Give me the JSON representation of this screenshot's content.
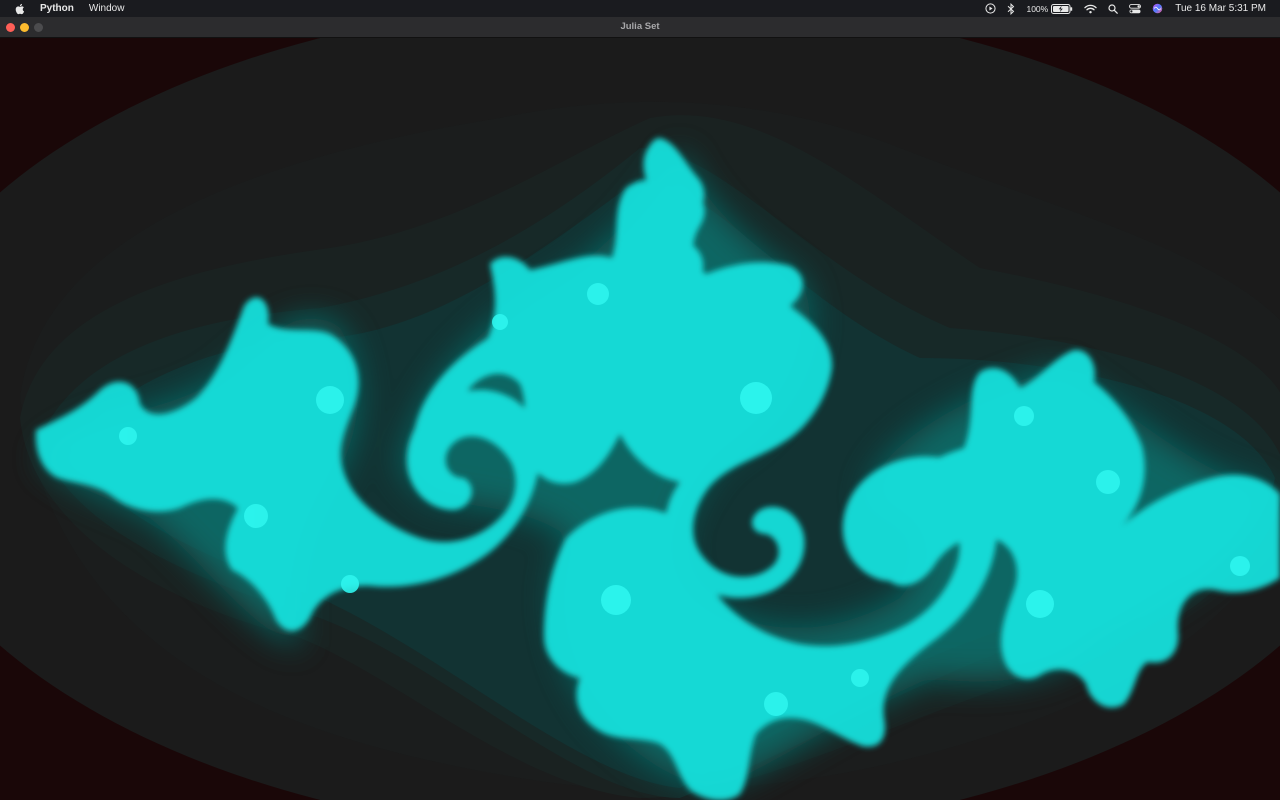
{
  "menubar": {
    "app_name": "Python",
    "menus": [
      "Window"
    ],
    "battery_percent": "100%",
    "clock": "Tue 16 Mar  5:31 PM",
    "icons": [
      "apple-icon",
      "play-icon",
      "bluetooth-icon",
      "battery-icon",
      "wifi-icon",
      "search-icon",
      "control-center-icon",
      "siri-icon"
    ]
  },
  "window": {
    "title": "Julia Set"
  },
  "colors": {
    "fractal": "#19e0dc",
    "glow": "#0a6f6c",
    "background": "#1c0505",
    "level": "#1b1b1b"
  }
}
